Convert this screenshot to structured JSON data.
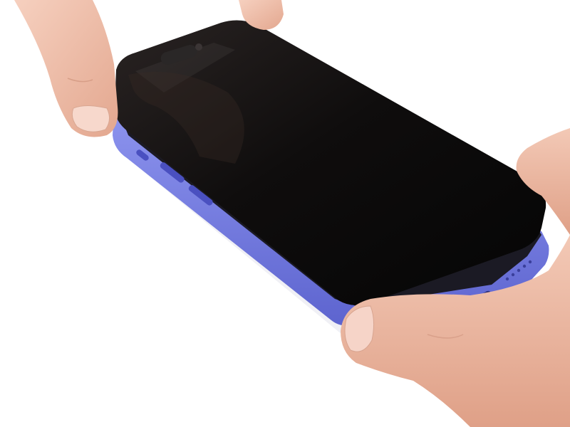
{
  "scene": {
    "description_label": "",
    "colors": {
      "background": "#ffffff",
      "phone_frame": "#7f86e6",
      "phone_frame_dark": "#5a60c8",
      "screen_glass": "#0f0d0d",
      "skin": "#f0c2ad",
      "skin_shadow": "#d99e86",
      "nail": "#f6d4c8"
    },
    "elements": {
      "phone": "smartphone-with-display-lifted",
      "hands": [
        "left-thumb-top",
        "right-fingers",
        "right-thumb-bottom"
      ]
    }
  }
}
